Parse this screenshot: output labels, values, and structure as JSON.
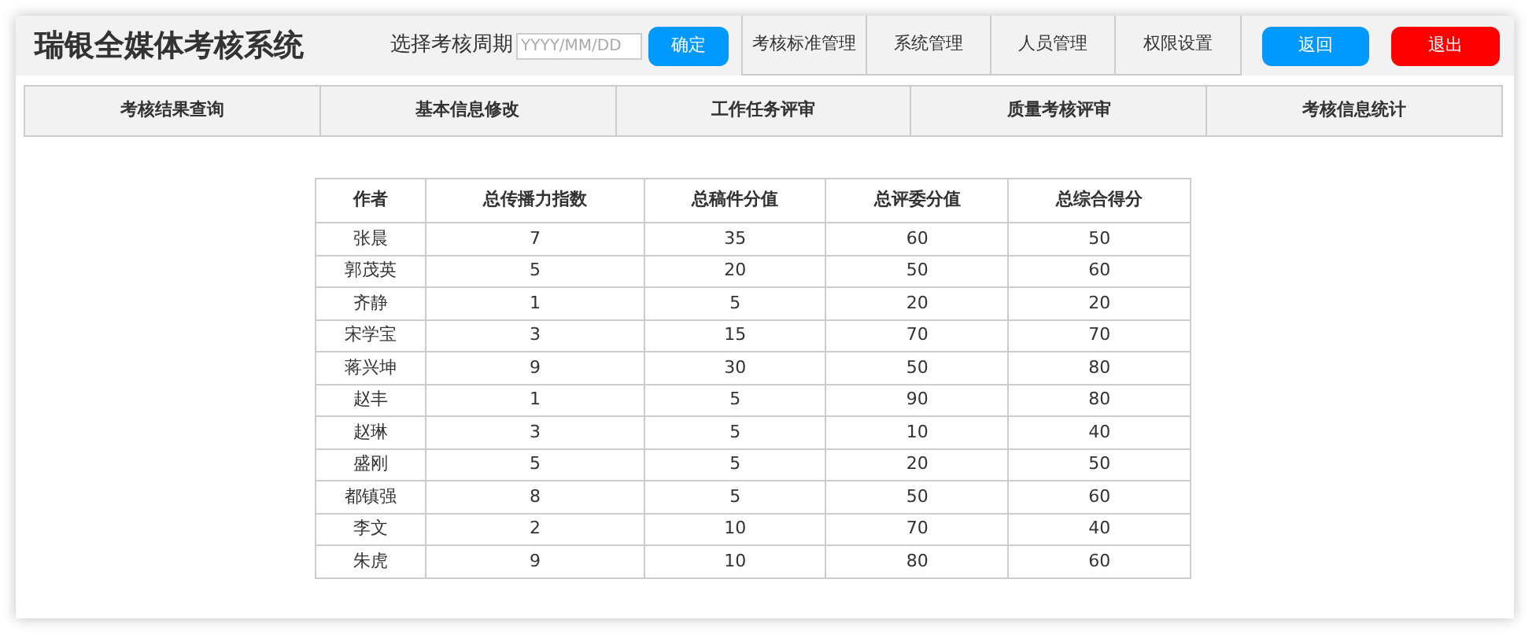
{
  "header": {
    "title": "瑞银全媒体考核系统",
    "period_label": "选择考核周期",
    "date_field": {
      "placeholder": "YYYY/MM/DD"
    },
    "confirm_button": "确定",
    "top_nav": [
      {
        "label": "考核标准管理"
      },
      {
        "label": "系统管理"
      },
      {
        "label": "人员管理"
      },
      {
        "label": "权限设置"
      }
    ],
    "actions": [
      {
        "label": "返回",
        "kind": "primary"
      },
      {
        "label": "退出",
        "kind": "danger"
      }
    ]
  },
  "menu": [
    {
      "label": "考核结果查询"
    },
    {
      "label": "基本信息修改"
    },
    {
      "label": "工作任务评审"
    },
    {
      "label": "质量考核评审"
    },
    {
      "label": "考核信息统计"
    }
  ],
  "table": {
    "columns": [
      "作者",
      "总传播力指数",
      "总稿件分值",
      "总评委分值",
      "总综合得分"
    ],
    "rows": [
      [
        "张晨",
        "7",
        "35",
        "60",
        "50"
      ],
      [
        "郭茂英",
        "5",
        "20",
        "50",
        "60"
      ],
      [
        "齐静",
        "1",
        "5",
        "20",
        "20"
      ],
      [
        "宋学宝",
        "3",
        "15",
        "70",
        "70"
      ],
      [
        "蒋兴坤",
        "9",
        "30",
        "50",
        "80"
      ],
      [
        "赵丰",
        "1",
        "5",
        "90",
        "80"
      ],
      [
        "赵琳",
        "3",
        "5",
        "10",
        "40"
      ],
      [
        "盛刚",
        "5",
        "5",
        "20",
        "50"
      ],
      [
        "都镇强",
        "8",
        "5",
        "50",
        "60"
      ],
      [
        "李文",
        "2",
        "10",
        "70",
        "40"
      ],
      [
        "朱虎",
        "9",
        "10",
        "80",
        "60"
      ]
    ]
  }
}
